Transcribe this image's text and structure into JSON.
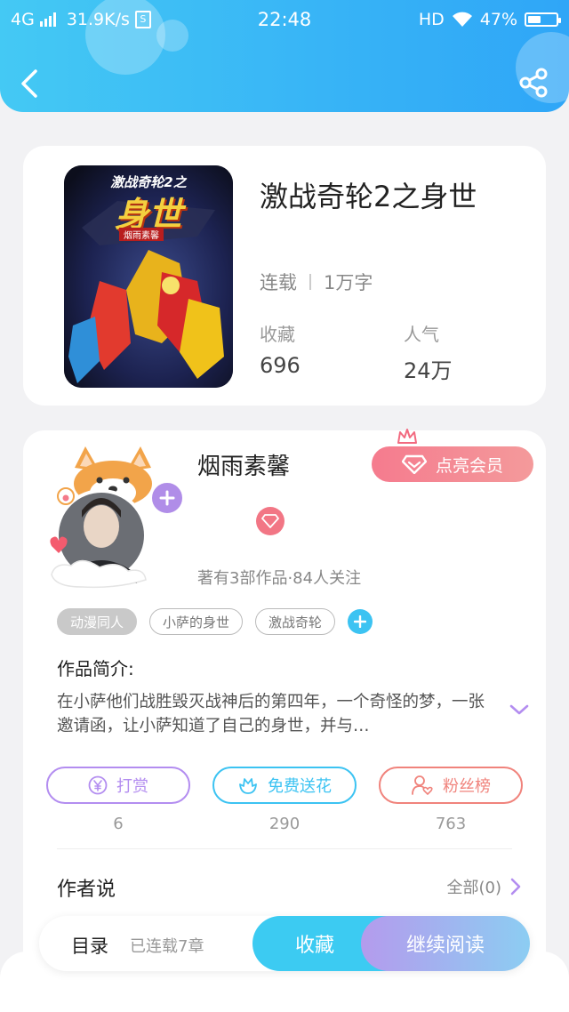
{
  "status_bar": {
    "network": "4G",
    "speed": "31.9K/s",
    "time": "22:48",
    "hd": "HD",
    "battery": "47%",
    "battery_level": 0.47
  },
  "book": {
    "title": "激战奇轮2之身世",
    "status": "连载",
    "word_count": "1万字",
    "favorites_label": "收藏",
    "favorites": "696",
    "popularity_label": "人气",
    "popularity": "24万",
    "cover_text": {
      "line1": "激战奇轮2之",
      "line2": "身世",
      "line3": "烟雨素馨"
    }
  },
  "author": {
    "name": "烟雨素馨",
    "vip_label": "点亮会员",
    "stats": "著有3部作品·84人关注"
  },
  "tags": [
    "动漫同人",
    "小萨的身世",
    "激战奇轮"
  ],
  "intro": {
    "heading": "作品简介:",
    "text": "在小萨他们战胜毁灭战神后的第四年，一个奇怪的梦，一张邀请函，让小萨知道了自己的身世，并与…"
  },
  "actions": [
    {
      "label": "打赏",
      "count": "6"
    },
    {
      "label": "免费送花",
      "count": "290"
    },
    {
      "label": "粉丝榜",
      "count": "763"
    }
  ],
  "author_says": {
    "heading": "作者说",
    "all": "全部(0)"
  },
  "bottom": {
    "toc": "目录",
    "chapters": "已连载7章",
    "favorite": "收藏",
    "continue": "继续阅读"
  },
  "colors": {
    "header": "#37b3f6",
    "accent_cyan": "#3ccbf2",
    "vip_pink": "#f57b8e",
    "reward_purple": "#b38df0",
    "flower_cyan": "#3cc3f2",
    "fans_red": "#f0837c"
  }
}
